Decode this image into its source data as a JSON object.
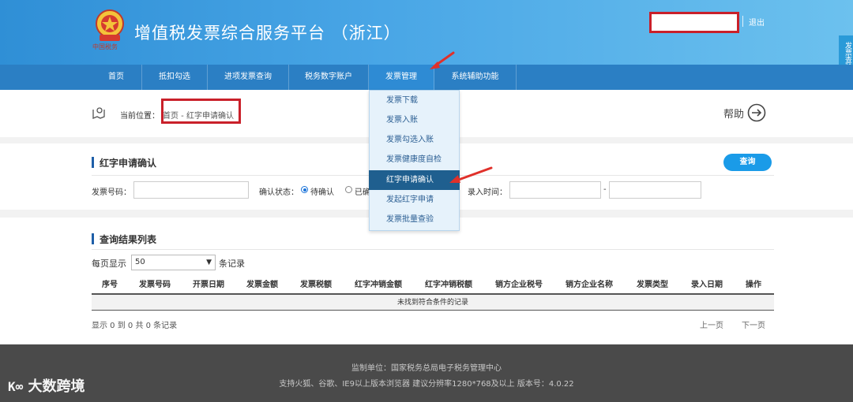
{
  "header": {
    "title": "增值税发票综合服务平台 （浙江）",
    "emblem_text": "中国税务",
    "logout": "退出",
    "side_tab": "发票查验平台"
  },
  "nav": {
    "items": [
      "首页",
      "抵扣勾选",
      "进项发票查询",
      "税务数字账户",
      "发票管理",
      "系统辅助功能"
    ],
    "active": "发票管理"
  },
  "dropdown": {
    "items": [
      "发票下载",
      "发票入账",
      "发票勾选入账",
      "发票健康度自检",
      "红字申请确认",
      "发起红字申请",
      "发票批量查验"
    ],
    "active": "红字申请确认"
  },
  "breadcrumb": {
    "label": "当前位置：",
    "path": "首页 - 红字申请确认",
    "help": "帮助"
  },
  "search": {
    "title": "红字申请确认",
    "query_button": "查询",
    "invoice_no_label": "发票号码：",
    "status_label": "确认状态：",
    "status_pending": "待确认",
    "status_done": "已确认",
    "entry_time_label": "录入时间：",
    "range_sep": "-"
  },
  "results": {
    "title": "查询结果列表",
    "per_page_label": "每页显示",
    "per_page_value": "50",
    "records_label": "条记录",
    "columns": [
      "序号",
      "发票号码",
      "开票日期",
      "发票金额",
      "发票税额",
      "红字冲销金额",
      "红字冲销税额",
      "销方企业税号",
      "销方企业名称",
      "发票类型",
      "录入日期",
      "操作"
    ],
    "empty_text": "未找到符合条件的记录",
    "summary": "显示 0 到 0 共 0 条记录",
    "prev": "上一页",
    "next": "下一页"
  },
  "footer": {
    "line1": "监制单位：国家税务总局电子税务管理中心",
    "line2": "支持火狐、谷歌、IE9以上版本浏览器    建议分辨率1280*768及以上    版本号：4.0.22"
  },
  "watermark": "大数跨境",
  "colors": {
    "header_start": "#2f8fd6",
    "nav": "#2b7fc4",
    "highlight_red": "#c9202a",
    "query_button": "#1a9be8",
    "dropdown_active": "#1f5f8f"
  }
}
